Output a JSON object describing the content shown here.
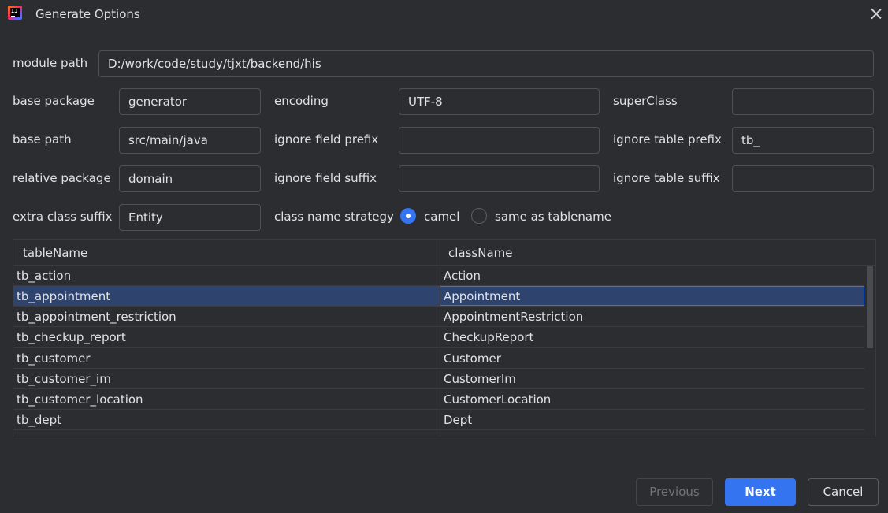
{
  "window": {
    "title": "Generate Options",
    "app_icon": "intellij-idea-icon",
    "app_icon_text": "IJ",
    "close_icon": "close-icon"
  },
  "form": {
    "module_path": {
      "label": "module path",
      "value": "D:/work/code/study/tjxt/backend/his"
    },
    "base_package": {
      "label": "base package",
      "value": "generator"
    },
    "encoding": {
      "label": "encoding",
      "value": "UTF-8"
    },
    "super_class": {
      "label": "superClass",
      "value": ""
    },
    "base_path": {
      "label": "base path",
      "value": "src/main/java"
    },
    "ignore_field_prefix": {
      "label": "ignore field prefix",
      "value": ""
    },
    "ignore_table_prefix": {
      "label": "ignore table prefix",
      "value": "tb_"
    },
    "relative_package": {
      "label": "relative package",
      "value": "domain"
    },
    "ignore_field_suffix": {
      "label": "ignore field suffix",
      "value": ""
    },
    "ignore_table_suffix": {
      "label": "ignore table suffix",
      "value": ""
    },
    "extra_class_suffix": {
      "label": "extra class suffix",
      "value": "Entity"
    },
    "class_name_strategy": {
      "label": "class name strategy",
      "options": [
        {
          "label": "camel",
          "selected": true
        },
        {
          "label": "same as tablename",
          "selected": false
        }
      ]
    }
  },
  "table": {
    "columns": [
      "tableName",
      "className"
    ],
    "rows": [
      {
        "tableName": "tb_action",
        "className": "Action",
        "selected": false
      },
      {
        "tableName": "tb_appointment",
        "className": "Appointment",
        "selected": true
      },
      {
        "tableName": "tb_appointment_restriction",
        "className": "AppointmentRestriction",
        "selected": false
      },
      {
        "tableName": "tb_checkup_report",
        "className": "CheckupReport",
        "selected": false
      },
      {
        "tableName": "tb_customer",
        "className": "Customer",
        "selected": false
      },
      {
        "tableName": "tb_customer_im",
        "className": "CustomerIm",
        "selected": false
      },
      {
        "tableName": "tb_customer_location",
        "className": "CustomerLocation",
        "selected": false
      },
      {
        "tableName": "tb_dept",
        "className": "Dept",
        "selected": false
      }
    ]
  },
  "buttons": {
    "previous": "Previous",
    "next": "Next",
    "cancel": "Cancel"
  },
  "colors": {
    "background": "#2b2d30",
    "accent": "#3574f0",
    "selection": "#2e436e",
    "border": "#4e5157"
  }
}
